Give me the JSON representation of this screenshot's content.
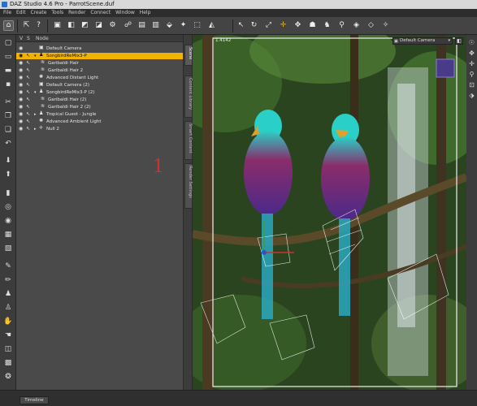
{
  "window": {
    "title": "DAZ Studio 4.6 Pro - ParrotScene.duf"
  },
  "menu": [
    "File",
    "Edit",
    "Create",
    "Tools",
    "Render",
    "Connect",
    "Window",
    "Help"
  ],
  "scene": {
    "headers": {
      "v": "V",
      "s": "S",
      "node": "Node"
    },
    "nodes": [
      {
        "label": "Default Camera",
        "icon": "camera-icon",
        "depth": 1,
        "expander": ""
      },
      {
        "label": "SongbirdReMix3-P",
        "icon": "figure-icon",
        "depth": 1,
        "expander": "▾",
        "selected": true
      },
      {
        "label": "Garibaldi Hair",
        "icon": "hair-icon",
        "depth": 2,
        "expander": ""
      },
      {
        "label": "Garibaldi Hair 2",
        "icon": "hair-icon",
        "depth": 2,
        "expander": ""
      },
      {
        "label": "Advanced Distant Light",
        "icon": "light-icon",
        "depth": 1,
        "expander": ""
      },
      {
        "label": "Default Camera (2)",
        "icon": "camera-icon",
        "depth": 1,
        "expander": ""
      },
      {
        "label": "SongbirdReMix3-P (2)",
        "icon": "figure-icon",
        "depth": 1,
        "expander": "▾"
      },
      {
        "label": "Garibaldi Hair (2)",
        "icon": "hair-icon",
        "depth": 2,
        "expander": ""
      },
      {
        "label": "Garibaldi Hair 2 (2)",
        "icon": "hair-icon",
        "depth": 2,
        "expander": ""
      },
      {
        "label": "Tropical Guest - Jungle",
        "icon": "figure-icon",
        "depth": 1,
        "expander": "▸"
      },
      {
        "label": "Advanced Ambient Light",
        "icon": "light-icon",
        "depth": 1,
        "expander": ""
      },
      {
        "label": "Null 2",
        "icon": "null-icon",
        "depth": 1,
        "expander": "▸"
      }
    ],
    "annotation": "1"
  },
  "side_tabs": [
    "Scene",
    "Content Library",
    "Smart Content",
    "Render Settings"
  ],
  "viewport": {
    "aspect_label": "1.4142",
    "camera_label": "Default Camera"
  },
  "bottom": {
    "timeline_tab": "Timeline"
  },
  "colors": {
    "selection": "#f2b300",
    "annotation": "#d03030",
    "accent_blue": "#2e6fbf"
  }
}
